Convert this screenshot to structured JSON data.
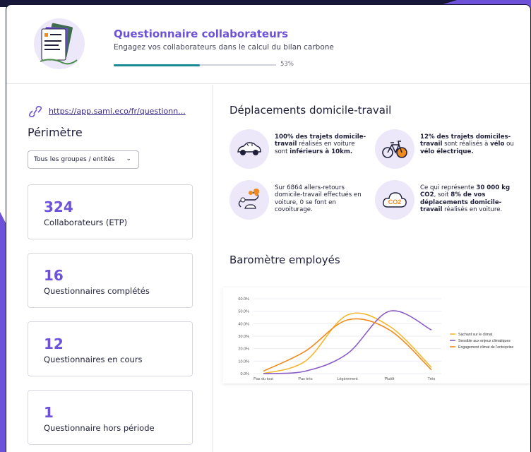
{
  "header": {
    "title": "Questionnaire collaborateurs",
    "subtitle": "Engagez vos collaborateurs dans le calcul du bilan carbone",
    "progress_percent": 53,
    "progress_label": "53%"
  },
  "sidebar": {
    "link": "https://app.sami.eco/fr/questionn...",
    "perimeter_title": "Périmètre",
    "filter_value": "Tous les groupes / entités",
    "stats": [
      {
        "value": "324",
        "label": "Collaborateurs (ETP)"
      },
      {
        "value": "16",
        "label": "Questionnaires complétés"
      },
      {
        "value": "12",
        "label": "Questionnaires en cours"
      },
      {
        "value": "1",
        "label": "Questionnaire hors période"
      }
    ]
  },
  "commute": {
    "title": "Déplacements domicile-travail",
    "facts": [
      {
        "icon": "car-icon",
        "html": "<b>100% des trajets domicile-travail</b> réalisés en voiture sont <b>inférieurs à 10km.</b>"
      },
      {
        "icon": "bicycle-icon",
        "html": "<b>12% des trajets domiciles-travail</b> sont réalisés à <b>vélo</b> ou <b>vélo électrique.</b>"
      },
      {
        "icon": "route-icon",
        "html": "Sur 6864 allers-retours domicile-travail effectués en voiture, 0 se font en covoiturage."
      },
      {
        "icon": "co2-cloud-icon",
        "html": "Ce qui représente <b>30 000 kg CO2</b>, soit <b>8% de vos déplacements domicile-travail</b> réalisés en voiture."
      }
    ]
  },
  "barometer": {
    "title": "Baromètre employés"
  },
  "chart_data": {
    "type": "line",
    "categories": [
      "Pas du tout",
      "Pas très",
      "Légèrement",
      "Plutôt",
      "Très"
    ],
    "ylim": [
      0,
      60
    ],
    "yticks": [
      "0.0%",
      "10.0%",
      "20.0%",
      "30.0%",
      "40.0%",
      "50.0%",
      "60.0%"
    ],
    "series": [
      {
        "name": "Sachant sur le climat",
        "color": "#f5b82e",
        "values": [
          0,
          10,
          47,
          38,
          5
        ]
      },
      {
        "name": "Sensible aux enjeux climatiques",
        "color": "#8a5cc6",
        "values": [
          0,
          2,
          16,
          50,
          35
        ]
      },
      {
        "name": "Engagement climat de l'entreprise",
        "color": "#f08a1c",
        "values": [
          2,
          18,
          43,
          35,
          3
        ]
      }
    ],
    "legend": "right"
  }
}
